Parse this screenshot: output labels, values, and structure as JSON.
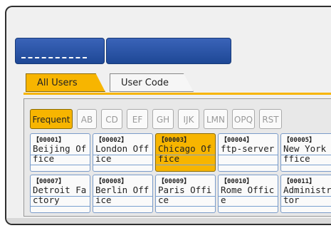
{
  "top_buttons": [
    {
      "name": "top-button-1"
    },
    {
      "name": "top-button-2"
    }
  ],
  "tabs": [
    {
      "label": "All Users",
      "active": true
    },
    {
      "label": "User Code",
      "active": false
    }
  ],
  "index_tabs": [
    "Frequent",
    "AB",
    "CD",
    "EF",
    "GH",
    "IJK",
    "LMN",
    "OPQ",
    "RST"
  ],
  "entries": [
    {
      "num": "【00001】",
      "line1": "Beijing Of",
      "line2": "fice",
      "selected": false
    },
    {
      "num": "【00002】",
      "line1": "London Off",
      "line2": "ice",
      "selected": false
    },
    {
      "num": "【00003】",
      "line1": "Chicago Of",
      "line2": "fice",
      "selected": true
    },
    {
      "num": "【00004】",
      "line1": "ftp-server",
      "line2": "",
      "selected": false
    },
    {
      "num": "【00005】",
      "line1": "New York",
      "line2": "ffice",
      "selected": false
    },
    {
      "num": "【00007】",
      "line1": "Detroit Fa",
      "line2": "ctory",
      "selected": false
    },
    {
      "num": "【00008】",
      "line1": "Berlin Off",
      "line2": "ice",
      "selected": false
    },
    {
      "num": "【00009】",
      "line1": "Paris Offi",
      "line2": "ce",
      "selected": false
    },
    {
      "num": "【00010】",
      "line1": "Rome Offic",
      "line2": "e",
      "selected": false
    },
    {
      "num": "【00011】",
      "line1": "Administr",
      "line2": "tor",
      "selected": false
    }
  ],
  "colors": {
    "accent": "#f7b500",
    "button_blue": "#2a55a8",
    "entry_border": "#7a9bc9"
  }
}
